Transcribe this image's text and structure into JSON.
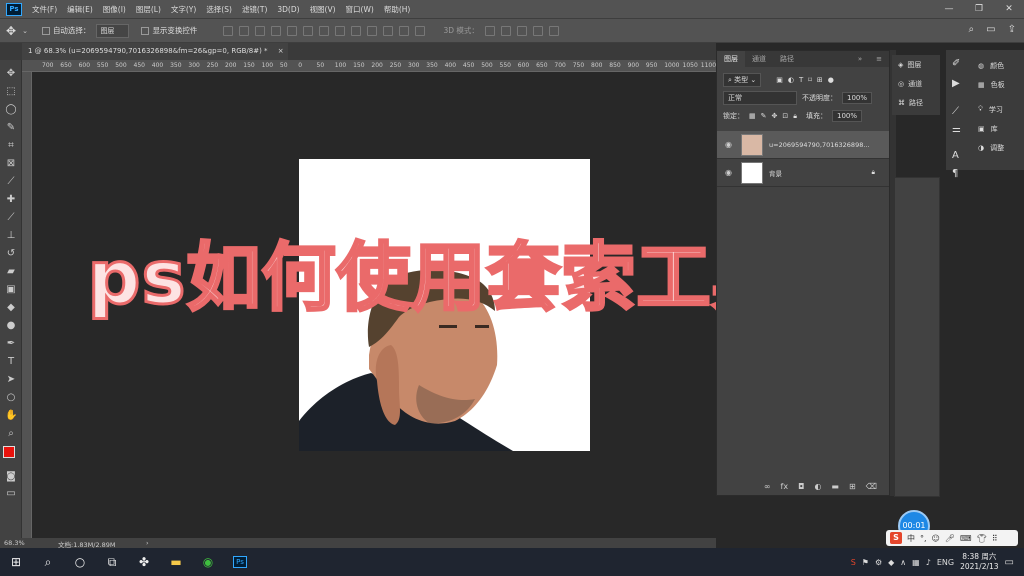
{
  "menubar": {
    "logo": "Ps",
    "items": [
      "文件(F)",
      "编辑(E)",
      "图像(I)",
      "图层(L)",
      "文字(Y)",
      "选择(S)",
      "滤镜(T)",
      "3D(D)",
      "视图(V)",
      "窗口(W)",
      "帮助(H)"
    ],
    "window_controls": [
      "—",
      "❐",
      "✕"
    ]
  },
  "options": {
    "auto_select_label": "自动选择：",
    "auto_select_value": "图层",
    "show_transform_label": "显示变换控件",
    "mode_3d_label": "3D 模式："
  },
  "document": {
    "tab_title": "1 @ 68.3% (u=2069594790,7016326898&fm=26&gp=0, RGB/8#) *",
    "close": "×"
  },
  "ruler": {
    "ticks": [
      "700",
      "650",
      "600",
      "550",
      "500",
      "450",
      "400",
      "350",
      "300",
      "250",
      "200",
      "150",
      "100",
      "50",
      "0",
      "50",
      "100",
      "150",
      "200",
      "250",
      "300",
      "350",
      "400",
      "450",
      "500",
      "550",
      "600",
      "650",
      "700",
      "750",
      "800",
      "850",
      "900",
      "950",
      "1000",
      "1050",
      "1100",
      "1150"
    ]
  },
  "layers_panel": {
    "tabs": [
      "图层",
      "通道",
      "路径"
    ],
    "filter_kind": "类型",
    "blend_mode": "正常",
    "opacity_label": "不透明度：",
    "opacity_value": "100%",
    "lock_label": "锁定：",
    "fill_label": "填充：",
    "fill_value": "100%",
    "layers": [
      {
        "name": "u=2069594790,7016326898..."
      },
      {
        "name": "背景"
      }
    ],
    "footer_icons": [
      "link-icon",
      "fx-icon",
      "mask-icon",
      "adjustment-icon",
      "folder-icon",
      "new-layer-icon",
      "trash-icon"
    ]
  },
  "dock1": {
    "items": [
      "图层",
      "通道",
      "路径"
    ]
  },
  "dock2": {
    "items": [
      "颜色",
      "色板",
      "学习",
      "库",
      "调整"
    ]
  },
  "status": {
    "zoom": "68.3%",
    "doc_size": "文档:1.83M/2.89M"
  },
  "overlay_title": "ps如何使用套索工具扣图",
  "timer": "00:01",
  "ime": {
    "logo": "S",
    "lang": "中"
  },
  "taskbar": {
    "tray_items": [
      "∧",
      "ENG"
    ],
    "time": "8:38 周六",
    "date": "2021/2/13"
  },
  "colors": {
    "foreground": "#e8120c",
    "background": "#000000",
    "overlay_stroke": "#ea6a6a"
  }
}
